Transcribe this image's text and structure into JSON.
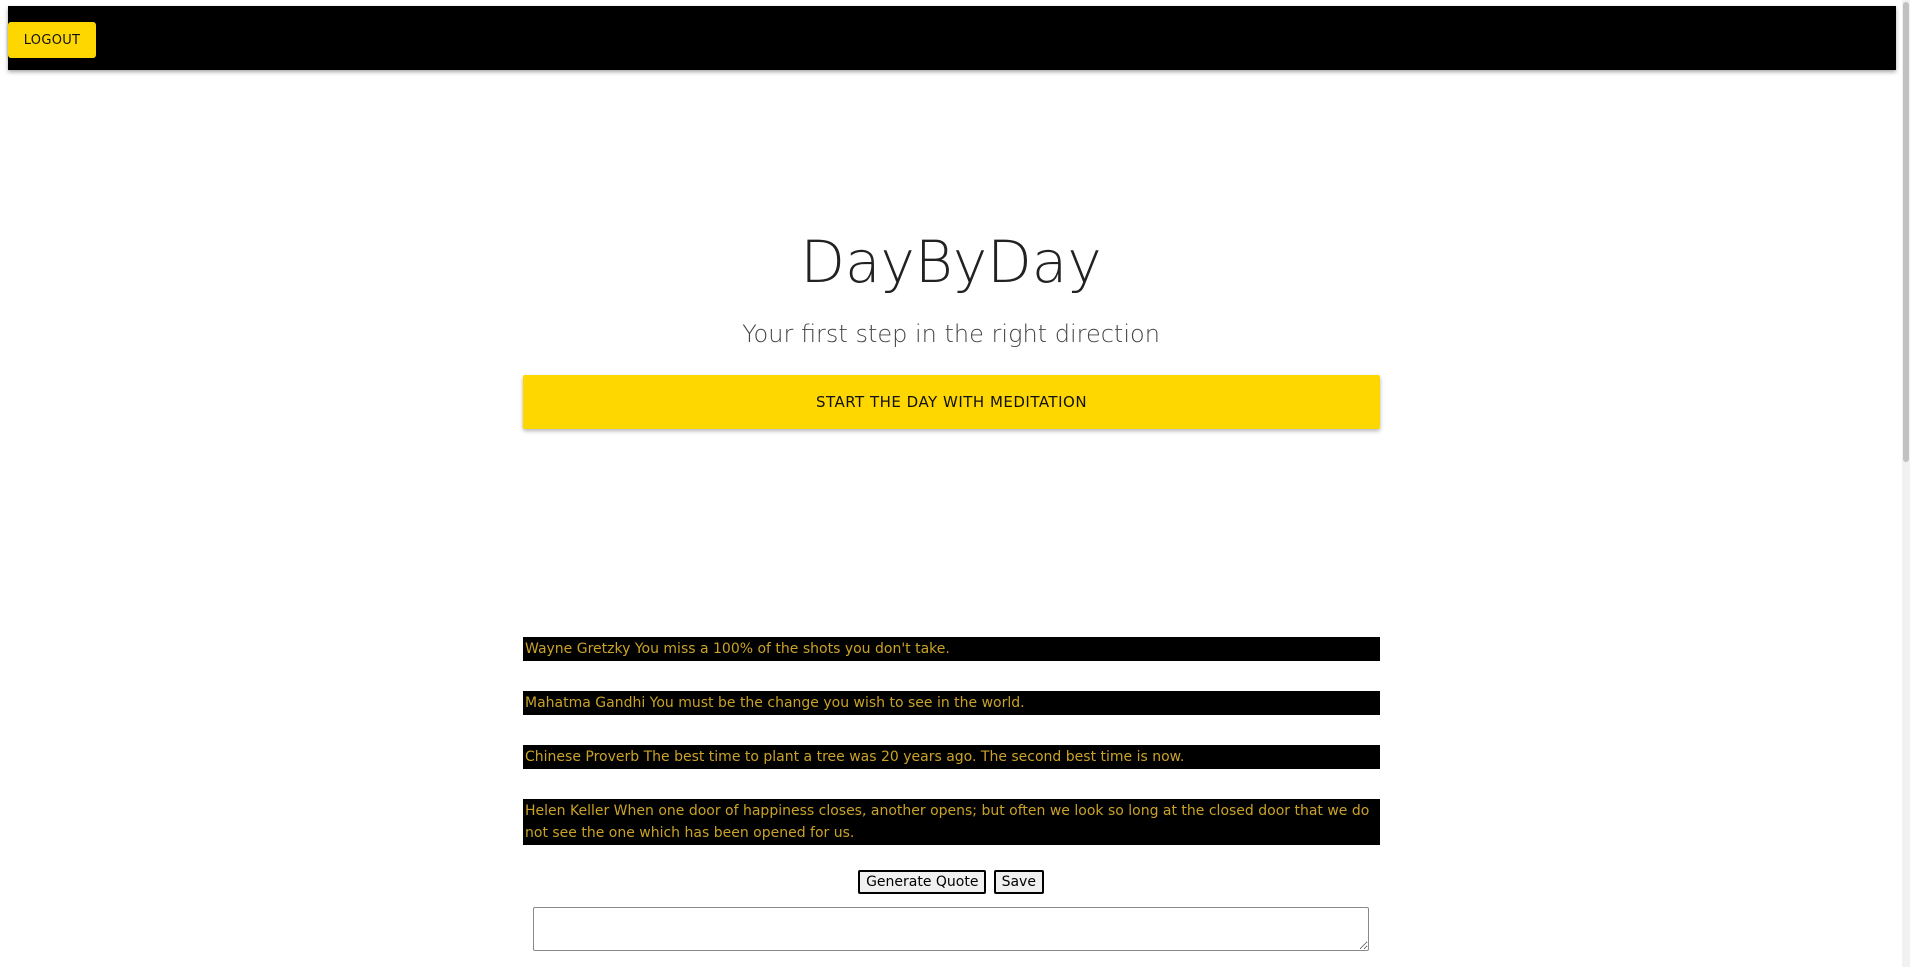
{
  "header": {
    "logout_label": "LOGOUT"
  },
  "hero": {
    "title": "DayByDay",
    "subtitle": "Your first step in the right direction",
    "meditation_label": "START THE DAY WITH MEDITATION"
  },
  "quotes": [
    "Wayne Gretzky You miss a 100% of the shots you don't take.",
    "Mahatma Gandhi You must be the change you wish to see in the world.",
    "Chinese Proverb The best time to plant a tree was 20 years ago. The second best time is now.",
    "Helen Keller When one door of happiness closes, another opens; but often we look so long at the closed door that we do not see the one which has been opened for us."
  ],
  "controls": {
    "generate_label": "Generate Quote",
    "save_label": "Save"
  },
  "notes": {
    "value": ""
  },
  "colors": {
    "accent": "#FFD700",
    "header_bg": "#000000",
    "quote_text": "#c9a227"
  }
}
